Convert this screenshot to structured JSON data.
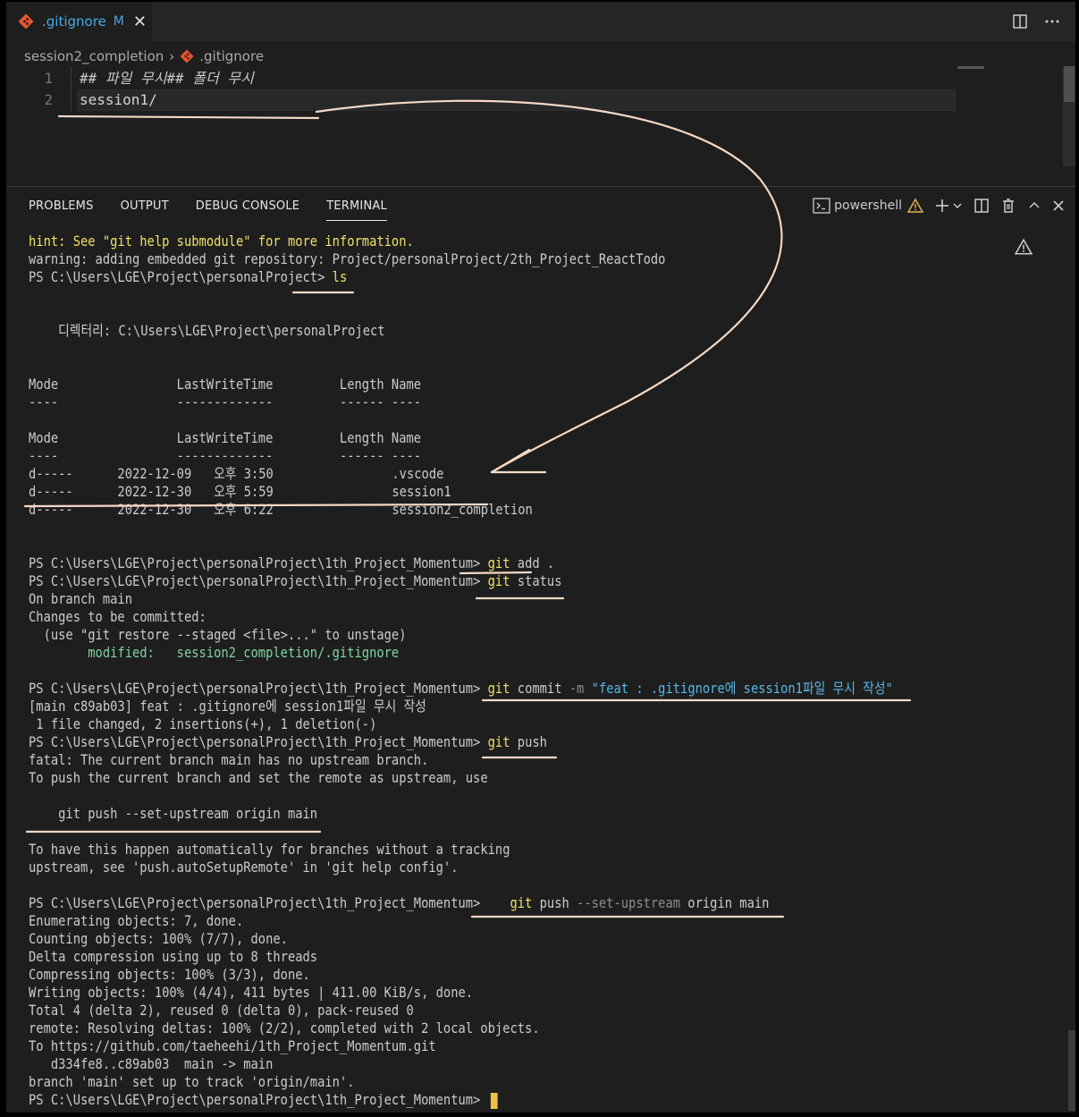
{
  "editor": {
    "tab": {
      "filename": ".gitignore",
      "status": "M"
    },
    "breadcrumb": {
      "folder": "session2_completion",
      "file": ".gitignore"
    },
    "lines": [
      {
        "number": "1",
        "text": "## 파일 무시## 폴더 무시"
      },
      {
        "number": "2",
        "text": "session1/"
      }
    ]
  },
  "panel": {
    "tabs": [
      "PROBLEMS",
      "OUTPUT",
      "DEBUG CONSOLE",
      "TERMINAL"
    ],
    "active_tab": "TERMINAL",
    "shell": "powershell"
  },
  "terminal": {
    "prompt_root": "PS C:\\Users\\LGE\\Project\\personalProject>",
    "prompt_repo": "PS C:\\Users\\LGE\\Project\\personalProject\\1th_Project_Momentum>",
    "hint": "hint: See \"git help submodule\" for more information.",
    "warning": "warning: adding embedded git repository: Project/personalProject/2th_Project_ReactTodo",
    "cmd_ls": "ls",
    "dir_header": "    디렉터리: C:\\Users\\LGE\\Project\\personalProject",
    "col_header": "Mode                LastWriteTime         Length Name",
    "col_rule": "----                -------------         ------ ----",
    "dir_rows": [
      "d-----      2022-12-09   오후 3:50                .vscode",
      "d-----      2022-12-30   오후 5:59                session1",
      "d-----      2022-12-30   오후 6:22                session2_completion"
    ],
    "cmd_add": {
      "git": "git",
      "args": " add ."
    },
    "cmd_status": {
      "git": "git",
      "args": " status"
    },
    "status_out": [
      "On branch main",
      "Changes to be committed:",
      "  (use \"git restore --staged <file>...\" to unstage)"
    ],
    "modified_label": "        modified:   ",
    "modified_file": "session2_completion/.gitignore",
    "cmd_commit": {
      "git": "git",
      "args": " commit ",
      "flag": "-m",
      "message": " \"feat : .gitignore에 session1파일 무시 작성\""
    },
    "commit_out": [
      "[main c89ab03] feat : .gitignore에 session1파일 무시 작성",
      " 1 file changed, 2 insertions(+), 1 deletion(-)"
    ],
    "cmd_push": {
      "git": "git",
      "args": " push"
    },
    "push_fail": [
      "fatal: The current branch main has no upstream branch.",
      "To push the current branch and set the remote as upstream, use",
      "",
      "    git push --set-upstream origin main",
      "",
      "To have this happen automatically for branches without a tracking",
      "upstream, see 'push.autoSetupRemote' in 'git help config'."
    ],
    "cmd_push_upstream": {
      "git": "git",
      "push": " push ",
      "flag": "--set-upstream",
      "rest": " origin main"
    },
    "push_out": [
      "Enumerating objects: 7, done.",
      "Counting objects: 100% (7/7), done.",
      "Delta compression using up to 8 threads",
      "Compressing objects: 100% (3/3), done.",
      "Writing objects: 100% (4/4), 411 bytes | 411.00 KiB/s, done.",
      "Total 4 (delta 2), reused 0 (delta 0), pack-reused 0",
      "remote: Resolving deltas: 100% (2/2), completed with 2 local objects.",
      "To https://github.com/taeheehi/1th_Project_Momentum.git",
      "   d334fe8..c89ab03  main -> main",
      "branch 'main' set up to track 'origin/main'."
    ]
  },
  "colors": {
    "annotation_stroke": "#f6d9c4",
    "git_icon": "#e8542f",
    "accent_blue": "#4aa9e8",
    "terminal_yellow": "#f0e269",
    "terminal_green": "#7fd4a0",
    "terminal_cyan": "#58b7e8"
  }
}
